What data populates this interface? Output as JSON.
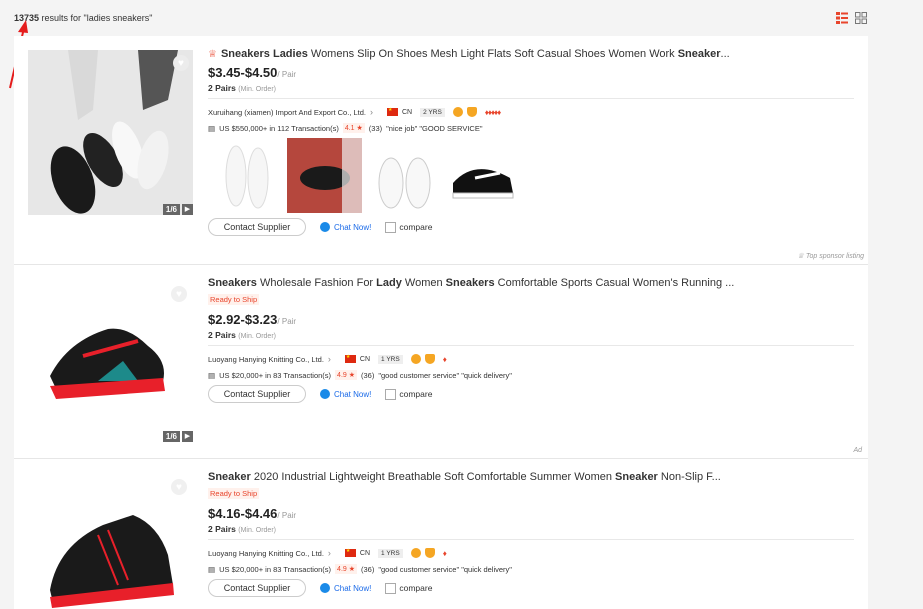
{
  "search": {
    "count": "13735",
    "suffix": " results for \"ladies sneakers\""
  },
  "view_icons": [
    "list-view-icon",
    "grid-view-icon"
  ],
  "labels": {
    "pager_count": "1/6",
    "contact": "Contact Supplier",
    "chat": "Chat Now!",
    "compare": "compare",
    "unit": "/ Pair",
    "min_order": "(Min. Order)",
    "sponsor": "Top sponsor listing",
    "ad": "Ad",
    "ready": "Ready to Ship"
  },
  "products": [
    {
      "title_parts": [
        {
          "text": "Sneakers",
          "kw": true
        },
        {
          "text": " ",
          "kw": false
        },
        {
          "text": "Ladies",
          "kw": true
        },
        {
          "text": " Womens Slip On Shoes Mesh Light Flats Soft Casual Shoes Women Work ",
          "kw": false
        },
        {
          "text": "Sneaker",
          "kw": true
        },
        {
          "text": "...",
          "kw": false
        }
      ],
      "price": "$3.45-$4.50",
      "moq": "2 Pairs",
      "supplier": "Xuruihang (xiamen) Import And Export Co., Ltd.",
      "country": "CN",
      "years": "2 YRS",
      "diamonds": "♦♦♦♦♦",
      "transactions": "US $550,000+ in 112 Transaction(s)",
      "rating": "4.1 ★",
      "reviews": "(33)",
      "tags": "\"nice job\"   \"GOOD SERVICE\""
    },
    {
      "title_parts": [
        {
          "text": "Sneakers",
          "kw": true
        },
        {
          "text": " Wholesale Fashion For ",
          "kw": false
        },
        {
          "text": "Lady",
          "kw": true
        },
        {
          "text": " Women ",
          "kw": false
        },
        {
          "text": "Sneakers",
          "kw": true
        },
        {
          "text": " Comfortable Sports Casual Women's Running ...",
          "kw": false
        }
      ],
      "price": "$2.92-$3.23",
      "moq": "2 Pairs",
      "supplier": "Luoyang Hanying Knitting Co., Ltd.",
      "country": "CN",
      "years": "1 YRS",
      "diamonds": "♦",
      "transactions": "US $20,000+ in 83 Transaction(s)",
      "rating": "4.9 ★",
      "reviews": "(36)",
      "tags": "\"good customer service\"   \"quick delivery\""
    },
    {
      "title_parts": [
        {
          "text": "Sneaker",
          "kw": true
        },
        {
          "text": " 2020 Industrial Lightweight Breathable Soft Comfortable Summer Women ",
          "kw": false
        },
        {
          "text": "Sneaker",
          "kw": true
        },
        {
          "text": " Non-Slip F...",
          "kw": false
        }
      ],
      "price": "$4.16-$4.46",
      "moq": "2 Pairs",
      "supplier": "Luoyang Hanying Knitting Co., Ltd.",
      "country": "CN",
      "years": "1 YRS",
      "diamonds": "♦",
      "transactions": "US $20,000+ in 83 Transaction(s)",
      "rating": "4.9 ★",
      "reviews": "(36)",
      "tags": "\"good customer service\"   \"quick delivery\""
    }
  ],
  "colors": {
    "accent": "#e8452c",
    "chat": "#1a6ae8",
    "gold": "#f5a623"
  }
}
